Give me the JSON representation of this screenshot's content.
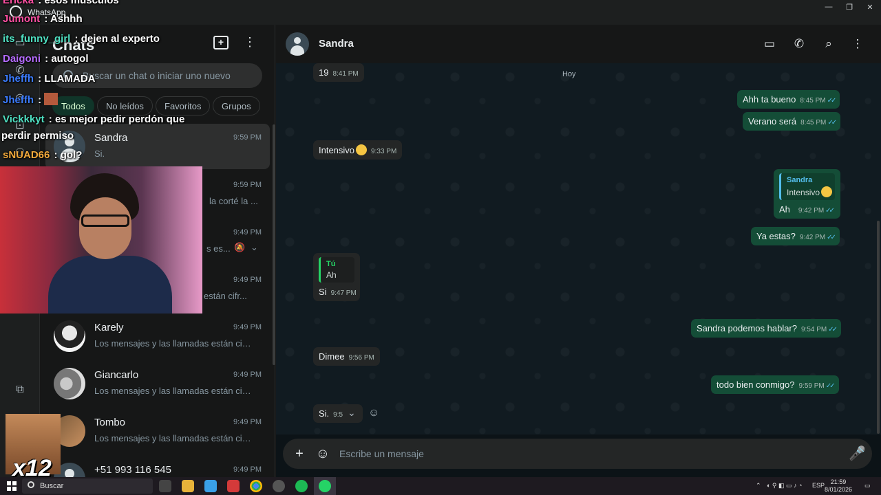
{
  "window": {
    "title": "WhatsApp",
    "minimize": "—",
    "maximize": "❐",
    "close": "✕"
  },
  "chatlist": {
    "title": "Chats",
    "search_placeholder": "Buscar un chat o iniciar uno nuevo",
    "filters": [
      "Todos",
      "No leídos",
      "Favoritos",
      "Grupos"
    ],
    "items": [
      {
        "name": "Sandra",
        "time": "9:59 PM",
        "preview": "Si."
      },
      {
        "name": "",
        "time": "9:59 PM",
        "preview": "la corté la ..."
      },
      {
        "name": "",
        "time": "9:49 PM",
        "preview": "s es..."
      },
      {
        "name": "",
        "time": "9:49 PM",
        "preview": "están cifr..."
      },
      {
        "name": "Karely",
        "time": "9:49 PM",
        "preview": "Los mensajes y las llamadas están cifr..."
      },
      {
        "name": "Giancarlo",
        "time": "9:49 PM",
        "preview": "Los mensajes y las llamadas están cifr..."
      },
      {
        "name": "Tombo",
        "time": "9:49 PM",
        "preview": "Los mensajes y las llamadas están cifr..."
      },
      {
        "name": "+51 993 116 545",
        "time": "9:49 PM",
        "preview": ""
      }
    ]
  },
  "conversation": {
    "contact_name": "Sandra",
    "date_chip": "Hoy",
    "messages": [
      {
        "dir": "in",
        "text": "19",
        "time": "8:41 PM"
      },
      {
        "dir": "out",
        "text": "Ahh ta bueno",
        "time": "8:45 PM"
      },
      {
        "dir": "out",
        "text": "Verano será",
        "time": "8:45 PM"
      },
      {
        "dir": "in",
        "text": "Intensivo",
        "time": "9:33 PM"
      },
      {
        "dir": "out",
        "quote_author": "Sandra",
        "quote_text": "Intensivo",
        "text": "Ah",
        "time": "9:42 PM"
      },
      {
        "dir": "out",
        "text": "Ya estas?",
        "time": "9:42 PM"
      },
      {
        "dir": "in",
        "quote_author": "Tú",
        "quote_text": "Ah",
        "text": "Si",
        "time": "9:47 PM"
      },
      {
        "dir": "out",
        "text": "Sandra podemos hablar?",
        "time": "9:54 PM"
      },
      {
        "dir": "in",
        "text": "Dimee",
        "time": "9:56 PM"
      },
      {
        "dir": "out",
        "text": "todo bien conmigo?",
        "time": "9:59 PM"
      },
      {
        "dir": "in",
        "text": "Si.",
        "time": "9:5"
      }
    ],
    "composer_placeholder": "Escribe un mensaje"
  },
  "stream_chat": [
    {
      "user": "Ericka",
      "text": "esos músculos",
      "color": "#ff4fa3"
    },
    {
      "user": "Jumont",
      "text": "Ashhh",
      "color": "#ff4fa3"
    },
    {
      "user": "its_funny_girl",
      "text": "dejen al experto",
      "color": "#4fe0c2"
    },
    {
      "user": "Daigoni",
      "text": "autogol",
      "color": "#b56cff"
    },
    {
      "user": "Jheffh",
      "text": "LLAMADA",
      "color": "#3b7cff"
    },
    {
      "user": "Jheffh",
      "text": "",
      "color": "#3b7cff"
    },
    {
      "user": "Vickkkyt",
      "text": "es mejor pedir perdón que",
      "color": "#4fe0c2"
    },
    {
      "user": "",
      "text": "perdir permiso",
      "color": "#ffffff"
    },
    {
      "user": "sNUAD66",
      "text": "gol?",
      "color": "#f2a93b"
    }
  ],
  "emote_label": "x12",
  "taskbar": {
    "search_placeholder": "Buscar",
    "lang": "ESP",
    "time": "21:59",
    "date": "8/01/2026"
  }
}
